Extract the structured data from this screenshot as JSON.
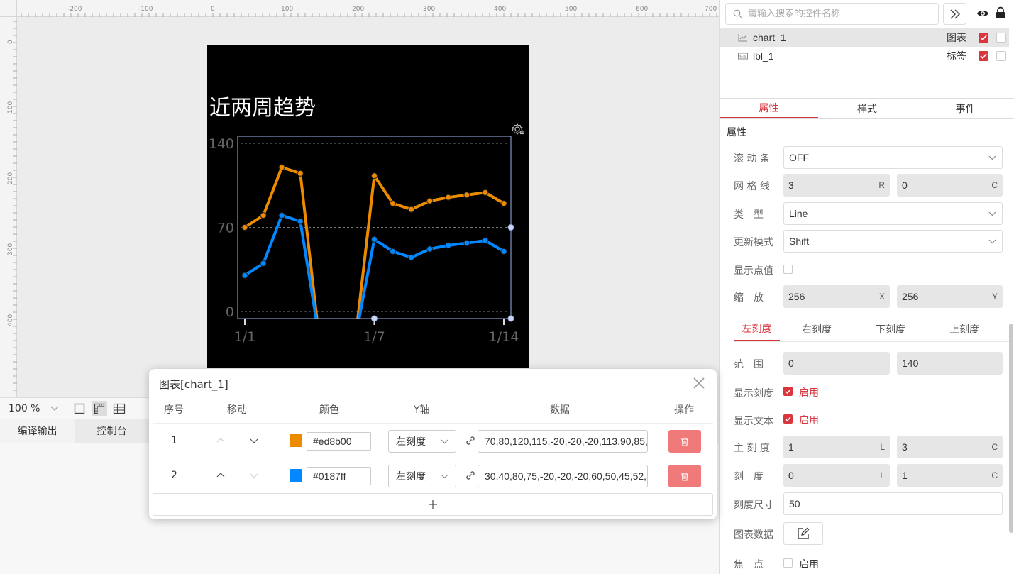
{
  "rulers": {
    "top": [
      "-200",
      "-100",
      "0",
      "100",
      "200",
      "300",
      "400",
      "500",
      "600",
      "700"
    ],
    "left": [
      "0",
      "100",
      "200",
      "300",
      "400"
    ]
  },
  "screen": {
    "title": "近两周趋势"
  },
  "chart_data": {
    "type": "line",
    "title": "",
    "xlabel": "",
    "ylabel": "",
    "x_tick_labels": [
      "1/1",
      "1/7",
      "1/14"
    ],
    "y_tick_labels": [
      "140",
      "70",
      "0"
    ],
    "ylim": [
      0,
      140
    ],
    "grid": "horizontal dashed",
    "points": 14,
    "series": [
      {
        "color": "#ed8b00",
        "values": [
          70,
          80,
          120,
          115,
          -20,
          -20,
          -20,
          113,
          90,
          85,
          92,
          95,
          97,
          99,
          90
        ]
      },
      {
        "color": "#0187ff",
        "values": [
          30,
          40,
          80,
          75,
          -20,
          -20,
          -20,
          60,
          50,
          45,
          52,
          55,
          57,
          59,
          50
        ]
      }
    ]
  },
  "toolbar": {
    "zoom": "100 %"
  },
  "output_tabs": {
    "compile": "编译输出",
    "console": "控制台"
  },
  "right": {
    "search_placeholder": "请输入搜索的控件名称",
    "layers": [
      {
        "name": "chart_1",
        "type": "图表",
        "selected": true
      },
      {
        "name": "lbl_1",
        "type": "标签",
        "selected": false
      }
    ],
    "tabs": [
      "属性",
      "样式",
      "事件"
    ],
    "section_title": "属性",
    "props": {
      "scrollbar_label": "滚 动 条",
      "scrollbar_value": "OFF",
      "grid_label": "网 格 线",
      "grid_r": "3",
      "grid_r_suffix": "R",
      "grid_c": "0",
      "grid_c_suffix": "C",
      "type_label": "类　型",
      "type_value": "Line",
      "update_label": "更新模式",
      "update_value": "Shift",
      "showval_label": "显示点值",
      "zoom_label": "缩　放",
      "zoom_x": "256",
      "zoom_x_suffix": "X",
      "zoom_y": "256",
      "zoom_y_suffix": "Y"
    },
    "scale_tabs": [
      "左刻度",
      "右刻度",
      "下刻度",
      "上刻度"
    ],
    "scale": {
      "range_label": "范　围",
      "range_min": "0",
      "range_max": "140",
      "show_ticks_label": "显示刻度",
      "show_ticks_value": "启用",
      "show_text_label": "显示文本",
      "show_text_value": "启用",
      "major_label": "主 刻 度",
      "major_l": "1",
      "major_l_suffix": "L",
      "major_c": "3",
      "major_c_suffix": "C",
      "minor_label": "刻　度",
      "minor_l": "0",
      "minor_l_suffix": "L",
      "minor_c": "1",
      "minor_c_suffix": "C",
      "size_label": "刻度尺寸",
      "size_value": "50",
      "chart_data_label": "图表数据",
      "focus_label": "焦　点",
      "focus_value": "启用"
    }
  },
  "dialog": {
    "title": "图表[chart_1]",
    "headers": [
      "序号",
      "移动",
      "颜色",
      "Y轴",
      "数据",
      "操作"
    ],
    "rows": [
      {
        "index": "1",
        "color": "#ed8b00",
        "axis": "左刻度",
        "data": "70,80,120,115,-20,-20,-20,113,90,85,92,95,97,99,90"
      },
      {
        "index": "2",
        "color": "#0187ff",
        "axis": "左刻度",
        "data": "30,40,80,75,-20,-20,-20,60,50,45,52,55,57,59,50"
      }
    ]
  }
}
